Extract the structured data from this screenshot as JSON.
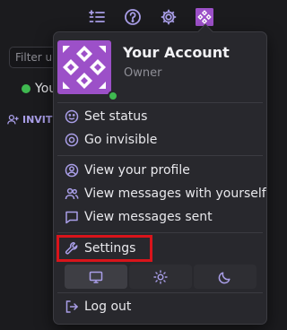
{
  "background": {
    "filter_placeholder": "Filter u",
    "user_label": "You",
    "invite_label": "INVITE"
  },
  "account": {
    "name": "Your Account",
    "role": "Owner",
    "status_color": "#3fb950",
    "avatar_colors": {
      "bg": "#9c50c8",
      "fg": "#ffffff"
    }
  },
  "menu": {
    "set_status": "Set status",
    "go_invisible": "Go invisible",
    "view_profile": "View your profile",
    "view_messages_self": "View messages with yourself",
    "view_messages_sent": "View messages sent",
    "settings": "Settings",
    "log_out": "Log out"
  },
  "theme": {
    "options": [
      "system",
      "light",
      "dark"
    ],
    "selected": "system"
  },
  "colors": {
    "accent": "#a99ee8",
    "highlight": "#d9141b"
  }
}
